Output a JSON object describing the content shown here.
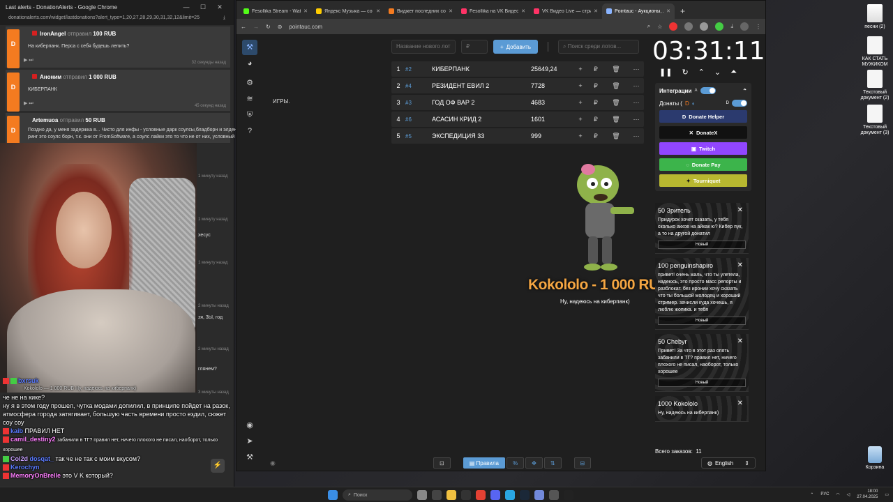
{
  "desktop": {
    "icons": [
      "песни (2)",
      "КАК СТАТЬ МУЖИКОМ",
      "Текстовый документ (2)",
      "Текстовый документ (3)",
      "Корзина"
    ]
  },
  "left_window": {
    "title": "Last alerts - DonationAlerts - Google Chrome",
    "url": "donationalerts.com/widget/lastdonations?alert_type=1,20,27,28,29,30,31,32,12&limit=25",
    "alerts": [
      {
        "name": "IronAngel",
        "verb": "отправил",
        "amount": "100 RUB",
        "message": "На киберпанк. Перса с себя будешь лепить?",
        "time": "32 секунды назад"
      },
      {
        "name": "Аноним",
        "verb": "отправил",
        "amount": "1 000 RUB",
        "message": "КИБЕРПАНК",
        "time": "45 секунд назад"
      },
      {
        "name": "Artemuoa",
        "verb": "отправил",
        "amount": "50 RUB",
        "message": "Поздно да, у меня задержка в... Чисто для инфы - условные дарк соулсы,бладборн и элден ринг это соулс борн, т.к. они от FromSoftware, а соулс лайки это то что не от них, условный",
        "time": ""
      }
    ],
    "side_times": [
      "1 минуту назад",
      "1 минуту назад",
      "1 минуту назад",
      "2 минуты назад",
      "2 минуты назад",
      "3 минуты назад"
    ],
    "side_snips": [
      "хесус",
      "зя, 3Ы, год",
      "глянем?"
    ]
  },
  "chat": [
    {
      "user": "bxrsuk",
      "text": ""
    },
    {
      "user": "",
      "text": "че не на кике?"
    },
    {
      "user": "",
      "text": "ну я в этом году прошел, чутка модами допилил, в принципе пойдет на разок, атмосфера города затягивает, большую часть времени просто ездил, сюжет соу соу"
    },
    {
      "user": "kaib",
      "text": "ПРАВИЛ НЕТ"
    },
    {
      "user": "camil_destiny2",
      "text": "забанили в ТГ? правил нет, ничего плохого не писал, наоборот, только хорошее"
    },
    {
      "user": "Col2d",
      "text": ""
    },
    {
      "user": "dosqat_",
      "text": "так че не так с моим вкусом?"
    },
    {
      "user": "Kerochyn",
      "text": ""
    },
    {
      "user": "MemoryOnBrelle",
      "text": "это V K который?"
    }
  ],
  "chat_overlay": {
    "name": "Kokololo",
    "amount": "1 000 RUB",
    "message": "Ну, надеюсь на киберпанк)"
  },
  "browser": {
    "tabs": [
      {
        "title": "Fesollika Stream - Watch L",
        "color": "#53fc18"
      },
      {
        "title": "Яндекс Музыка — со",
        "color": "#ffcc00"
      },
      {
        "title": "Виджет последних сооб",
        "color": "#f47b20"
      },
      {
        "title": "Fesollika на VK Видео Li",
        "color": "#ff3366"
      },
      {
        "title": "VK Видео Live — стримы",
        "color": "#ff3366"
      },
      {
        "title": "Pointauc - Аукционы, лот",
        "color": "#8ab4ff"
      }
    ],
    "url": "pointauc.com"
  },
  "auction": {
    "lot_name_placeholder": "Название нового лот",
    "amount_placeholder": "₽",
    "add_label": "Добавить",
    "search_placeholder": "Поиск среди лотов...",
    "side_text": "ИГРЫ.",
    "lots": [
      {
        "n": "1",
        "id": "#2",
        "name": "КИБЕРПАНК",
        "amount": "25649,24"
      },
      {
        "n": "2",
        "id": "#4",
        "name": "РЕЗИДЕНТ ЕВИЛ 2",
        "amount": "7728"
      },
      {
        "n": "3",
        "id": "#3",
        "name": "ГОД ОФ ВАР 2",
        "amount": "4683"
      },
      {
        "n": "4",
        "id": "#6",
        "name": "АСАСИН КРИД 2",
        "amount": "1601"
      },
      {
        "n": "5",
        "id": "#5",
        "name": "ЭКСПЕДИЦИЯ 33",
        "amount": "999"
      }
    ],
    "alert_title": "Kokololo - 1 000 RUB!",
    "alert_message": "Ну, надеюсь на киберпанк)",
    "timer": "03:31:11",
    "integrations_title": "Интеграции",
    "donations_label": "Донаты (",
    "integration_buttons": [
      {
        "label": "Donate Helper",
        "color": "#2b3a6e"
      },
      {
        "label": "DonateX",
        "color": "#111111"
      },
      {
        "label": "Twitch",
        "color": "#9146ff"
      },
      {
        "label": "Donate Pay",
        "color": "#3cb44b"
      },
      {
        "label": "Tourniquet",
        "color": "#b8b830"
      }
    ],
    "donations": [
      {
        "title": "50 Зритель",
        "message": "Придурок хочет сказать, у тебя сколько акков на айкак ю? Кибер пук, а то на другой донатил",
        "status": "Новый"
      },
      {
        "title": "100 penguinshapiro",
        "message": "привет! очень жаль, что ты улетела, надеюсь, это просто масс репорты и разблокат. без иронии хочу сказать что ты большой молодец и хороший стример. зачисли куда хочешь, я люблю жопика. и тебя",
        "status": "Новый"
      },
      {
        "title": "50 Chebyr",
        "message": "Привет! За что в этот раз опять забанили в ТГ? правил нет, ничего плохого не писал, наоборот, только хорошее",
        "status": "Новый"
      },
      {
        "title": "1000 Kokololo",
        "message": "Ну, надеюсь на киберпанк)",
        "status": ""
      }
    ],
    "total_label": "Всего заказов:",
    "total_value": "11",
    "language": "English",
    "bottom_buttons": [
      "Правила"
    ]
  },
  "taskbar": {
    "search": "Поиск",
    "lang": "РУС",
    "time": "18:00",
    "date": "27.04.2025"
  }
}
